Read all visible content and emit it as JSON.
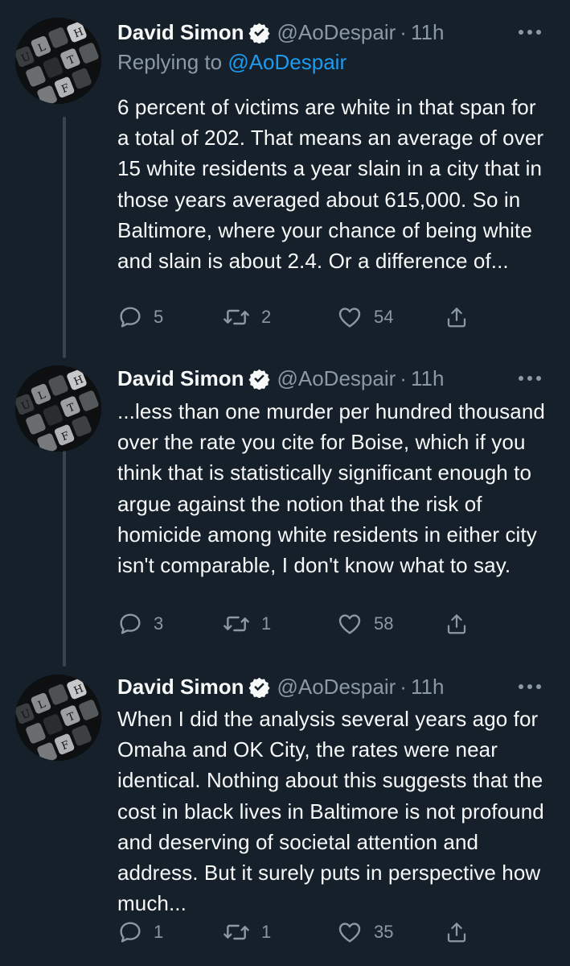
{
  "colors": {
    "background": "#15202b",
    "text_primary": "#f7f9f9",
    "text_secondary": "#8b98a5",
    "accent": "#1d9bf0",
    "thread_line": "#38444d"
  },
  "tweets": [
    {
      "author_name": "David Simon",
      "handle": "@AoDespair",
      "dot": "·",
      "time": "11h",
      "replying_label": "Replying to",
      "replying_to": "@AoDespair",
      "text": "6 percent of victims are white in that span for a total of 202. That means an average of over 15 white residents a year slain in a city that in those years averaged about 615,000. So in Baltimore, where your chance of being white and slain is about 2.4. Or a difference of...",
      "replies": "5",
      "retweets": "2",
      "likes": "54"
    },
    {
      "author_name": "David Simon",
      "handle": "@AoDespair",
      "dot": "·",
      "time": "11h",
      "text": "...less than one murder per hundred thousand over the rate you cite for Boise, which if you think that is statistically significant enough to argue against the notion that the risk of homicide among white residents in either city isn't comparable, I don't know what to say.",
      "replies": "3",
      "retweets": "1",
      "likes": "58"
    },
    {
      "author_name": "David Simon",
      "handle": "@AoDespair",
      "dot": "·",
      "time": "11h",
      "text": "When I did the analysis several years ago for Omaha and OK City, the rates were near identical. Nothing about this suggests that the cost in black lives in Baltimore is not profound and deserving of societal attention and address. But it surely puts in perspective how much...",
      "replies": "1",
      "retweets": "1",
      "likes": "35"
    }
  ],
  "icons": {
    "verified": "verified-badge-icon",
    "more": "more-options-icon",
    "reply": "reply-icon",
    "retweet": "retweet-icon",
    "like": "like-icon",
    "share": "share-icon"
  }
}
